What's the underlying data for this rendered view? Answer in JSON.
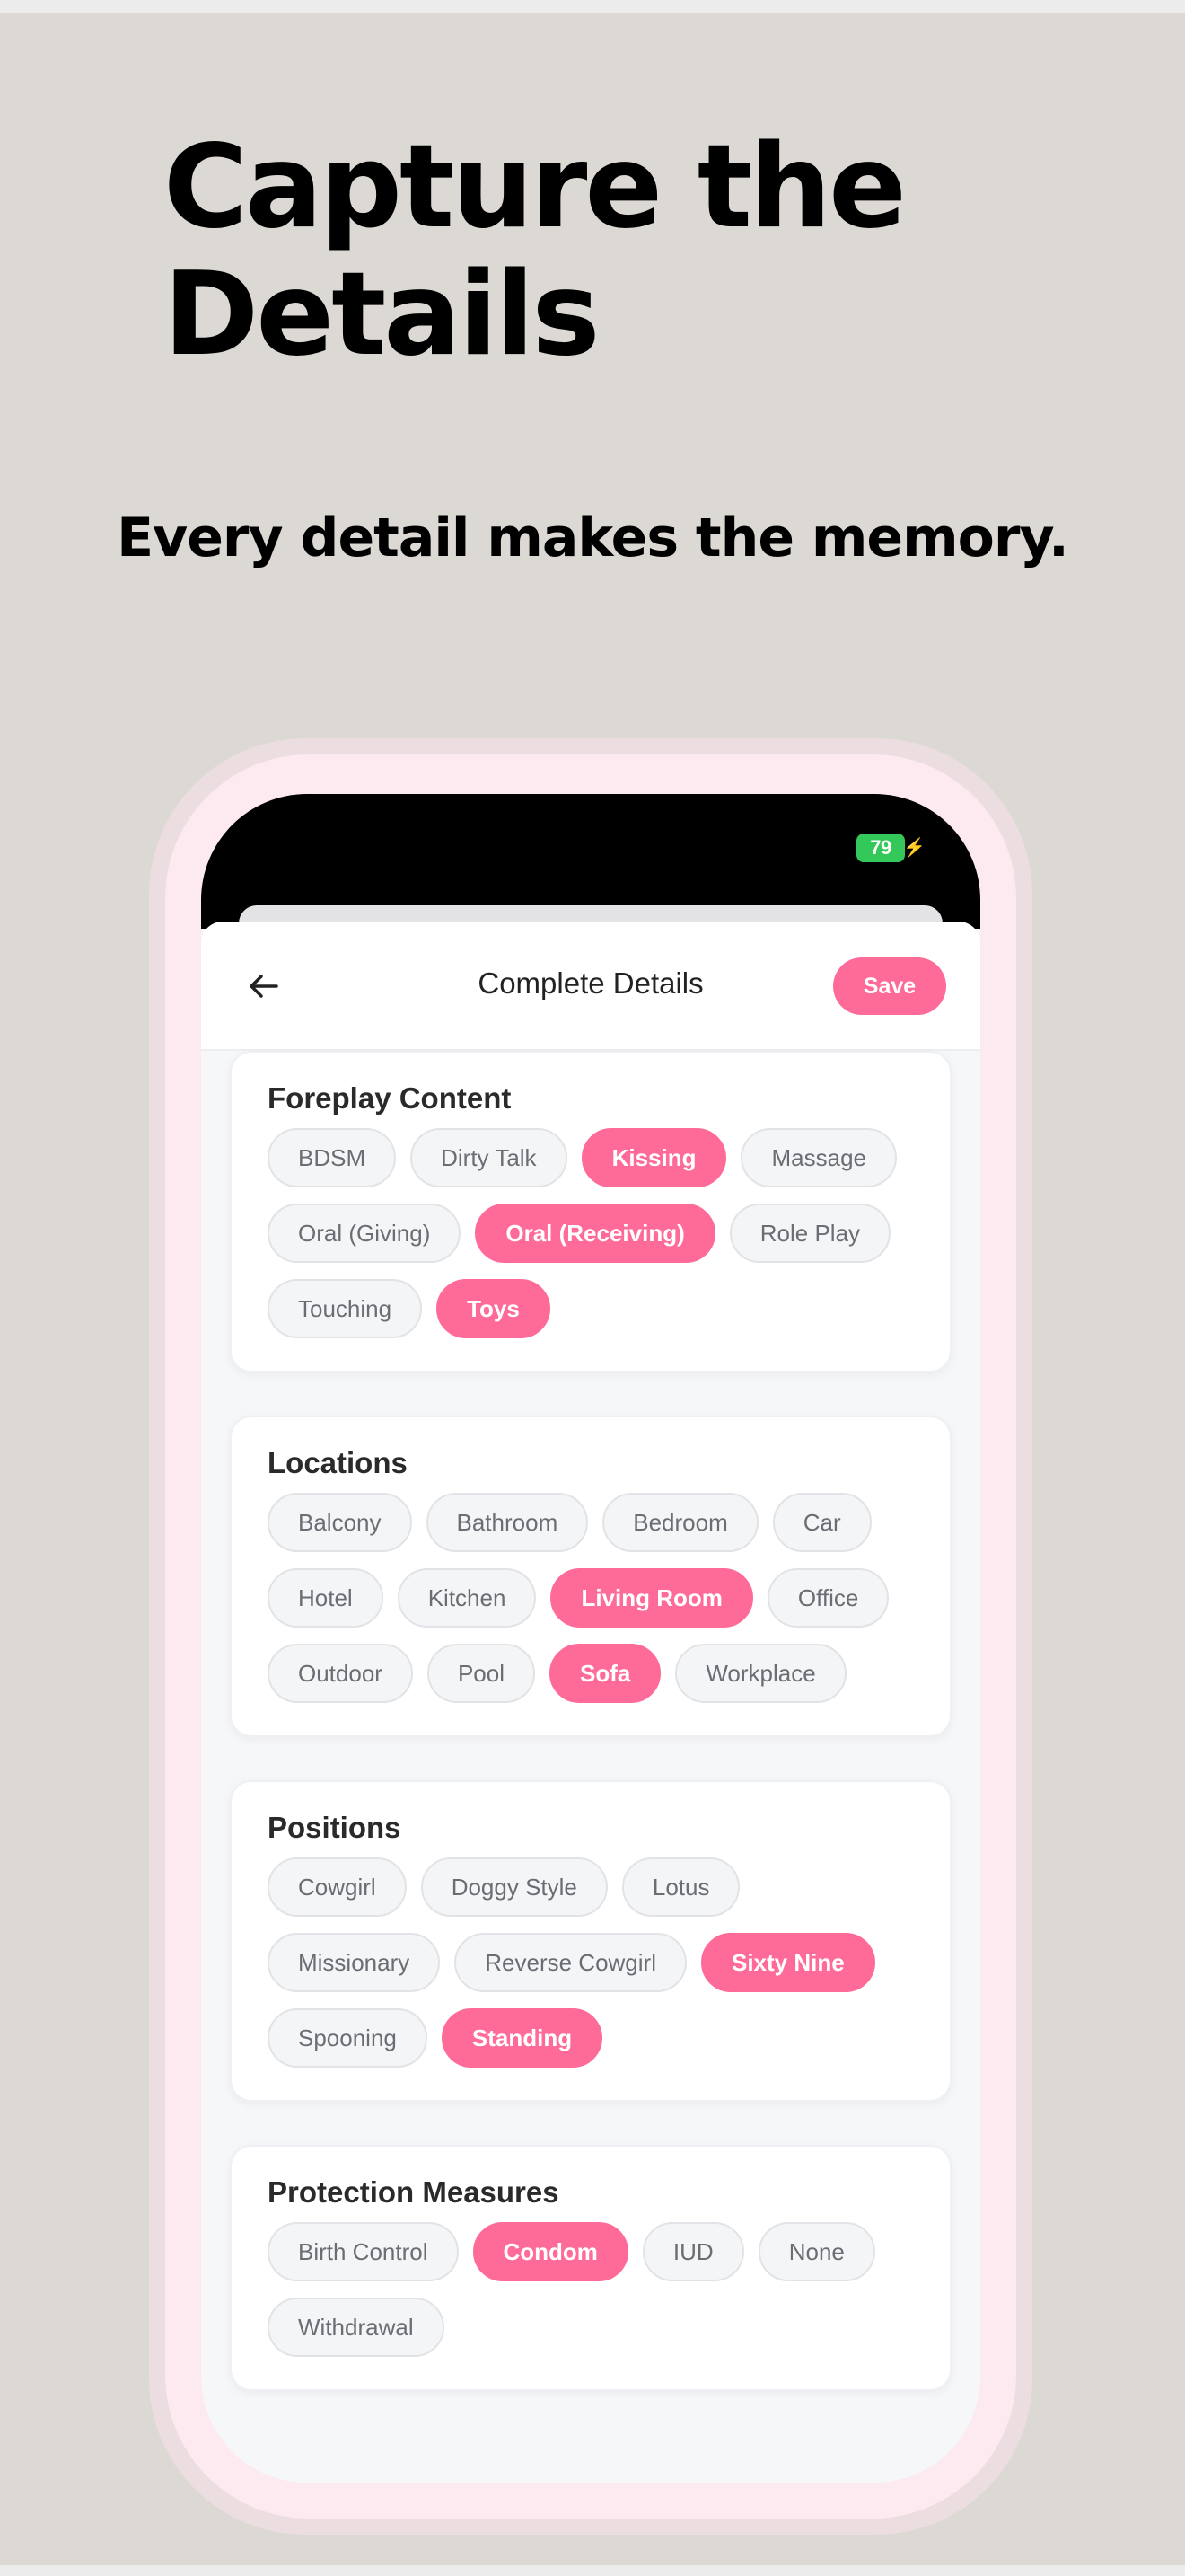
{
  "marketing": {
    "headline": "Capture the\nDetails",
    "subheadline": "Every detail makes the memory."
  },
  "status_bar": {
    "battery_level": "79"
  },
  "nav": {
    "back_icon": "arrow-left-icon",
    "title": "Complete Details",
    "save_label": "Save"
  },
  "colors": {
    "accent": "#ff6b98",
    "chip_background": "#f4f5f7",
    "chip_text": "#6a6d73",
    "backdrop": "#dcd9d5"
  },
  "sections": [
    {
      "title": "Foreplay Content",
      "options": [
        {
          "label": "BDSM",
          "selected": false
        },
        {
          "label": "Dirty Talk",
          "selected": false
        },
        {
          "label": "Kissing",
          "selected": true
        },
        {
          "label": "Massage",
          "selected": false
        },
        {
          "label": "Oral (Giving)",
          "selected": false
        },
        {
          "label": "Oral (Receiving)",
          "selected": true
        },
        {
          "label": "Role Play",
          "selected": false
        },
        {
          "label": "Touching",
          "selected": false
        },
        {
          "label": "Toys",
          "selected": true
        }
      ]
    },
    {
      "title": "Locations",
      "options": [
        {
          "label": "Balcony",
          "selected": false
        },
        {
          "label": "Bathroom",
          "selected": false
        },
        {
          "label": "Bedroom",
          "selected": false
        },
        {
          "label": "Car",
          "selected": false
        },
        {
          "label": "Hotel",
          "selected": false
        },
        {
          "label": "Kitchen",
          "selected": false
        },
        {
          "label": "Living Room",
          "selected": true
        },
        {
          "label": "Office",
          "selected": false
        },
        {
          "label": "Outdoor",
          "selected": false
        },
        {
          "label": "Pool",
          "selected": false
        },
        {
          "label": "Sofa",
          "selected": true
        },
        {
          "label": "Workplace",
          "selected": false
        }
      ]
    },
    {
      "title": "Positions",
      "options": [
        {
          "label": "Cowgirl",
          "selected": false
        },
        {
          "label": "Doggy Style",
          "selected": false
        },
        {
          "label": "Lotus",
          "selected": false
        },
        {
          "label": "Missionary",
          "selected": false
        },
        {
          "label": "Reverse Cowgirl",
          "selected": false
        },
        {
          "label": "Sixty Nine",
          "selected": true
        },
        {
          "label": "Spooning",
          "selected": false
        },
        {
          "label": "Standing",
          "selected": true
        }
      ]
    },
    {
      "title": "Protection Measures",
      "options": [
        {
          "label": "Birth Control",
          "selected": false
        },
        {
          "label": "Condom",
          "selected": true
        },
        {
          "label": "IUD",
          "selected": false
        },
        {
          "label": "None",
          "selected": false
        },
        {
          "label": "Withdrawal",
          "selected": false
        }
      ]
    }
  ]
}
